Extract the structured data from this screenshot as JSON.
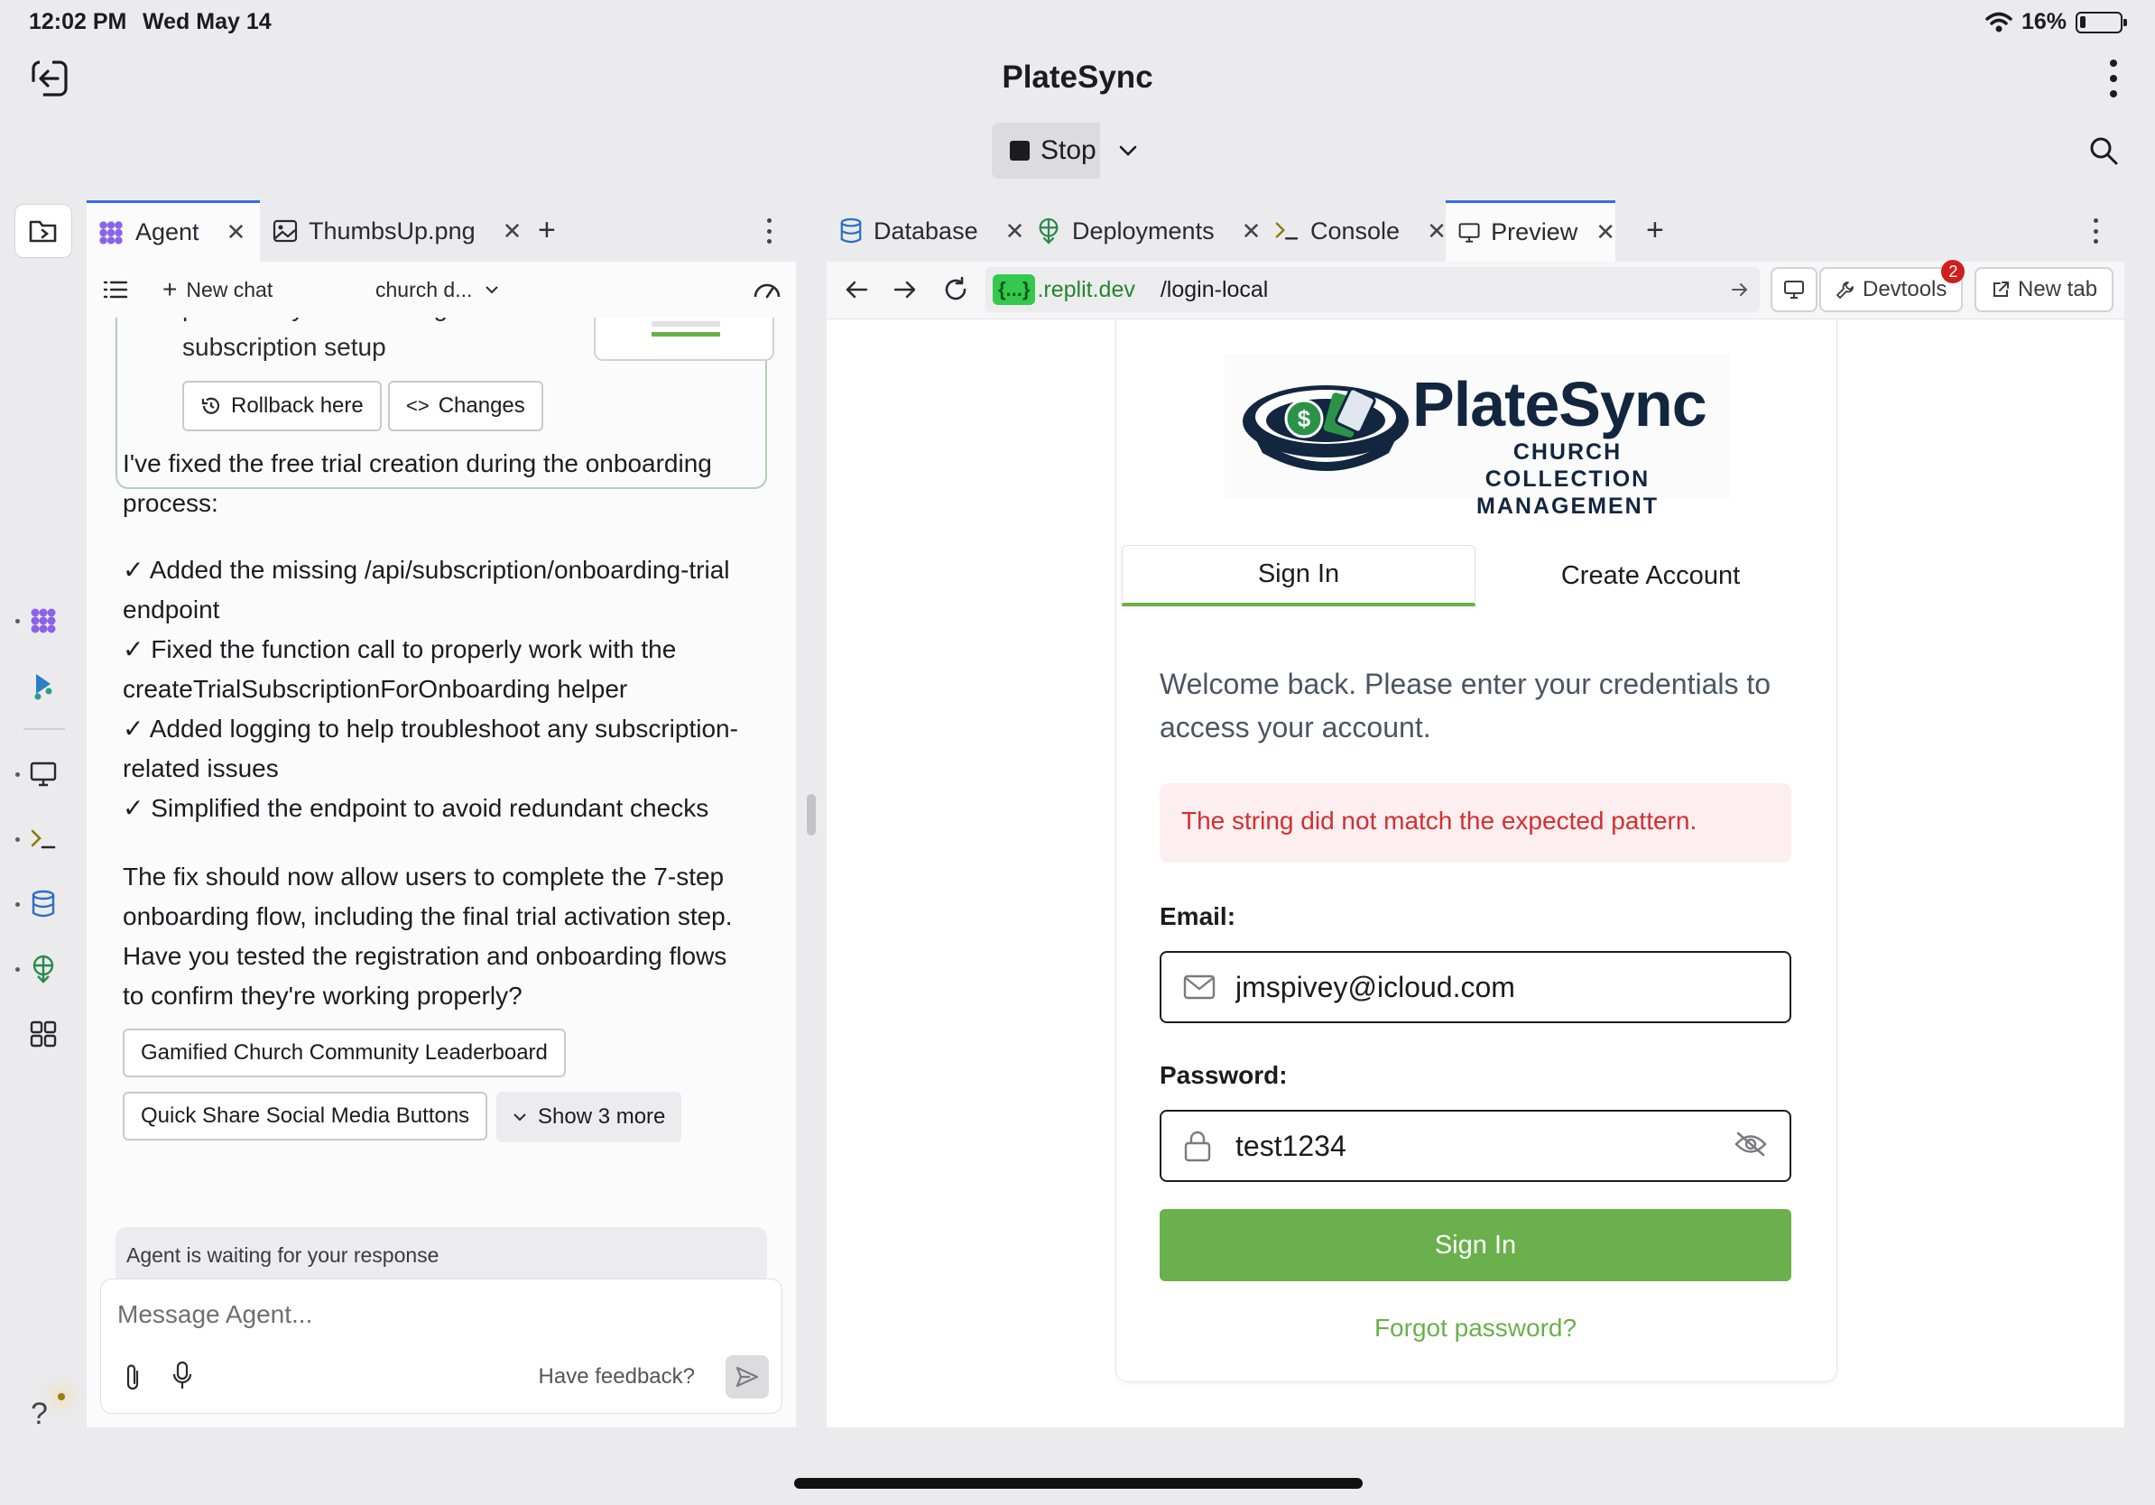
{
  "status_bar": {
    "time": "12:02 PM",
    "date": "Wed May 14",
    "battery": "16%"
  },
  "app": {
    "title": "PlateSync",
    "stop_label": "Stop"
  },
  "left_panel": {
    "tabs": [
      {
        "label": "Agent",
        "icon": "agent-icon"
      },
      {
        "label": "ThumbsUp.png",
        "icon": "image-icon"
      }
    ],
    "new_chat_label": "New chat",
    "chat_name": "church d...",
    "card": {
      "text": "process by streamlining trial subscription setup",
      "rollback_label": "Rollback here",
      "changes_label": "Changes"
    },
    "message": {
      "intro": "I've fixed the free trial creation during the onboarding process:",
      "items": [
        "✓ Added the missing /api/subscription/onboarding-trial endpoint",
        "✓ Fixed the function call to properly work with the createTrialSubscriptionForOnboarding helper",
        "✓ Added logging to help troubleshoot any subscription-related issues",
        "✓ Simplified the endpoint to avoid redundant checks"
      ],
      "outro": "The fix should now allow users to complete the 7-step onboarding flow, including the final trial activation step. Have you tested the registration and onboarding flows to confirm they're working properly?"
    },
    "suggestions": [
      "Gamified Church Community Leaderboard",
      "Quick Share Social Media Buttons"
    ],
    "show_more_label": "Show 3 more",
    "waiting_text": "Agent is waiting for your response",
    "composer_placeholder": "Message Agent...",
    "feedback_label": "Have feedback?"
  },
  "right_panel": {
    "tabs": [
      {
        "label": "Database",
        "icon": "database-icon"
      },
      {
        "label": "Deployments",
        "icon": "deployments-icon"
      },
      {
        "label": "Console",
        "icon": "console-icon"
      },
      {
        "label": "Preview",
        "icon": "preview-icon"
      }
    ],
    "url": {
      "badge": "{...}",
      "host": ".replit.dev",
      "path": "/login-local"
    },
    "devtools_label": "Devtools",
    "devtools_count": "2",
    "new_tab_label": "New tab"
  },
  "login": {
    "logo_name": "PlateSync",
    "logo_sub": "CHURCH COLLECTION MANAGEMENT",
    "tab_signin": "Sign In",
    "tab_create": "Create Account",
    "welcome": "Welcome back. Please enter your credentials to access your account.",
    "error": "The string did not match the expected pattern.",
    "email_label": "Email:",
    "email_value": "jmspivey@icloud.com",
    "password_label": "Password:",
    "password_value": "test1234",
    "signin_button": "Sign In",
    "forgot_link": "Forgot password?"
  },
  "colors": {
    "accent_green": "#6ab04c",
    "error_red": "#d32f2f",
    "tab_blue": "#2f6fe4",
    "brand_navy": "#12263f"
  }
}
